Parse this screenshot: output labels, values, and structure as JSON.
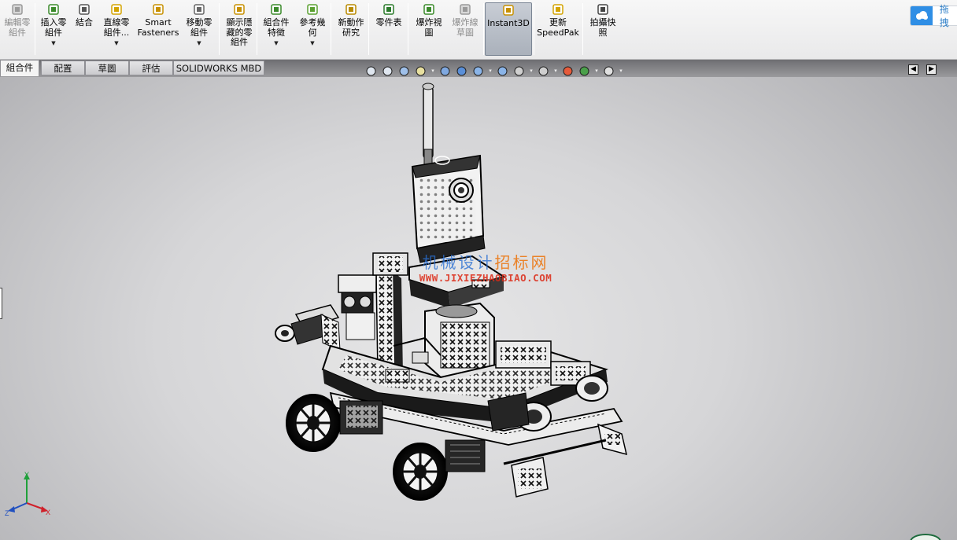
{
  "ribbon": {
    "buttons": [
      {
        "id": "edit-component",
        "label": "編輯零\n組件",
        "icon": "edit-component-icon",
        "disabled": true,
        "dropdown": false
      },
      {
        "id": "insert-components",
        "label": "插入零\n組件",
        "icon": "insert-component-icon",
        "disabled": false,
        "dropdown": true
      },
      {
        "id": "mate",
        "label": "結合",
        "icon": "mate-paperclip-icon",
        "disabled": false,
        "dropdown": false
      },
      {
        "id": "linear-pattern",
        "label": "直線零\n組件...",
        "icon": "linear-pattern-icon",
        "disabled": false,
        "dropdown": true
      },
      {
        "id": "smart-fasteners",
        "label": "Smart\nFasteners",
        "icon": "smart-fasteners-icon",
        "disabled": false,
        "dropdown": false
      },
      {
        "id": "move-component",
        "label": "移動零\n組件",
        "icon": "move-component-icon",
        "disabled": false,
        "dropdown": true
      },
      {
        "id": "show-hidden",
        "label": "顯示隱\n藏的零\n組件",
        "icon": "show-hidden-icon",
        "disabled": false,
        "dropdown": false
      },
      {
        "id": "assembly-features",
        "label": "組合件\n特徵",
        "icon": "assembly-features-icon",
        "disabled": false,
        "dropdown": true
      },
      {
        "id": "reference-geometry",
        "label": "參考幾\n何",
        "icon": "reference-geometry-icon",
        "disabled": false,
        "dropdown": true
      },
      {
        "id": "new-motion-study",
        "label": "新動作\n研究",
        "icon": "motion-study-icon",
        "disabled": false,
        "dropdown": false
      },
      {
        "id": "bom",
        "label": "零件表",
        "icon": "bill-of-materials-icon",
        "disabled": false,
        "dropdown": false
      },
      {
        "id": "exploded-view",
        "label": "爆炸視\n圖",
        "icon": "exploded-view-icon",
        "disabled": false,
        "dropdown": false
      },
      {
        "id": "explode-line",
        "label": "爆炸線\n草圖",
        "icon": "explode-line-sketch-icon",
        "disabled": true,
        "dropdown": false
      },
      {
        "id": "instant3d",
        "label": "Instant3D",
        "icon": "instant3d-icon",
        "disabled": false,
        "dropdown": false,
        "active": true
      },
      {
        "id": "update-speedpak",
        "label": "更新\nSpeedPak",
        "icon": "speedpak-icon",
        "disabled": false,
        "dropdown": false
      },
      {
        "id": "snapshot",
        "label": "拍攝快\n照",
        "icon": "snapshot-icon",
        "disabled": false,
        "dropdown": false
      }
    ],
    "cloud_text": "拖拽"
  },
  "tabs": [
    {
      "label": "組合件",
      "active": true
    },
    {
      "label": "配置",
      "active": false
    },
    {
      "label": "草圖",
      "active": false
    },
    {
      "label": "評估",
      "active": false
    },
    {
      "label": "SOLIDWORKS MBD",
      "active": false
    }
  ],
  "hud": {
    "icons": [
      "zoom-to-fit-icon",
      "zoom-to-area-icon",
      "previous-view-icon",
      "section-view-icon",
      "view-orientation-icon",
      "display-style-icon",
      "hide-show-items-icon",
      "edit-appearance-icon",
      "apply-scene-icon",
      "view-settings-icon",
      "appearance-sphere-icon",
      "scene-icon",
      "monitor-icon"
    ]
  },
  "watermark": {
    "line1_blue": "机械设计",
    "line1_orange": "招标网",
    "line2": "WWW.JIXIEZHAOBIAO.COM"
  },
  "triad": {
    "x": "X",
    "y": "Y",
    "z": "Z"
  },
  "colors": {
    "x_axis": "#d0202a",
    "y_axis": "#1fa03a",
    "z_axis": "#2050c0",
    "active_button": "#aab1bb"
  }
}
